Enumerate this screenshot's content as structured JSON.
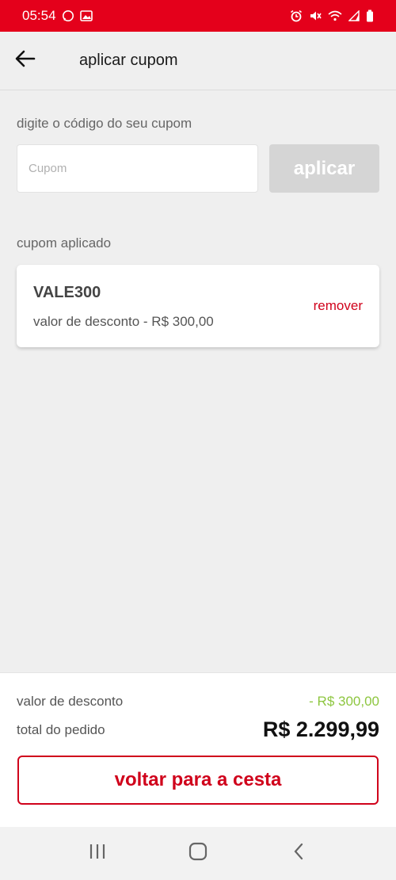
{
  "status_bar": {
    "time": "05:54",
    "icons": [
      "whatsapp-icon",
      "image-icon",
      "alarm-icon",
      "mute-icon",
      "wifi-icon",
      "signal-icon",
      "battery-icon"
    ]
  },
  "header": {
    "title": "aplicar cupom"
  },
  "coupon_form": {
    "label": "digite o código do seu cupom",
    "input_value": "",
    "input_placeholder": "Cupom",
    "apply_label": "aplicar"
  },
  "applied": {
    "section_label": "cupom aplicado",
    "code": "VALE300",
    "description": "valor de desconto - R$ 300,00",
    "remove_label": "remover"
  },
  "summary": {
    "discount_label": "valor de desconto",
    "discount_value": "- R$ 300,00",
    "total_label": "total do pedido",
    "total_value": "R$ 2.299,99",
    "back_to_cart_label": "voltar para a cesta"
  },
  "colors": {
    "brand_red": "#e4001b",
    "accent_red": "#d0021b",
    "discount_green": "#8dc63f",
    "disabled_gray": "#d5d5d5"
  }
}
